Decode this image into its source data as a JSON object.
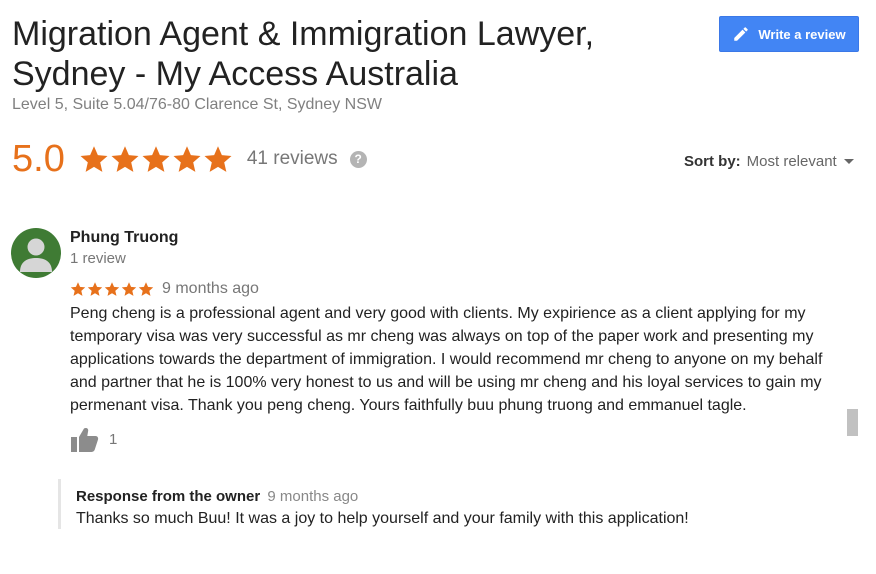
{
  "business": {
    "title_line1": "Migration Agent & Immigration Lawyer,",
    "title_line2": "Sydney - My Access Australia",
    "address": "Level 5, Suite 5.04/76-80 Clarence St, Sydney NSW"
  },
  "actions": {
    "write_review_label": "Write a review"
  },
  "summary": {
    "rating": "5.0",
    "stars": 5,
    "review_count": "41 reviews",
    "help_glyph": "?"
  },
  "sort": {
    "label": "Sort by:",
    "value": "Most relevant"
  },
  "review": {
    "author": "Phung Truong",
    "author_reviews": "1 review",
    "stars": 5,
    "date": "9 months ago",
    "text": "Peng cheng is a professional agent and very good with clients. My expirience as a client applying for my temporary visa was very successful as mr cheng was always on top of the paper work and presenting my applications towards the department of immigration. I would recommend mr cheng to anyone on my behalf and partner that he is 100% very honest to us and will be using mr cheng and his loyal services to gain my permenant visa. Thank you peng cheng. Yours faithfully buu phung truong and emmanuel tagle.",
    "likes": "1",
    "owner_response": {
      "label": "Response from the owner",
      "date": "9 months ago",
      "text": "Thanks so much Buu! It was a joy to help yourself and your family with this application!"
    }
  },
  "colors": {
    "star": "#e7711b",
    "button": "#4285f4",
    "avatar": "#3f7b34"
  },
  "icons": {
    "write": "pencil-icon",
    "help": "help-icon",
    "sort": "caret-down-icon",
    "avatar": "default-avatar-icon",
    "like": "thumbs-up-icon",
    "star": "star-icon"
  }
}
